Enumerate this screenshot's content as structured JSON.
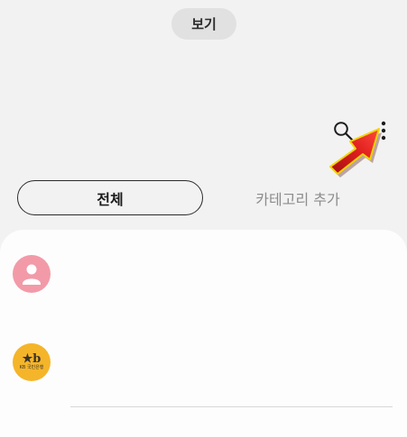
{
  "header": {
    "view_button_label": "보기"
  },
  "toolbar": {
    "search_icon": "search-icon",
    "more_icon": "more-options-icon"
  },
  "tabs": [
    {
      "label": "전체",
      "selected": true
    },
    {
      "label": "카테고리 추가",
      "selected": false
    }
  ],
  "contacts": [
    {
      "avatar": "person-avatar",
      "avatar_color": "#f29aa8"
    },
    {
      "avatar": "kb-bank-logo",
      "avatar_color": "#f5b52a",
      "logo_text": "KB 국민은행",
      "logo_mark": "★b"
    }
  ],
  "overlay": {
    "pointer_color": "#e0201f",
    "pointer_outline": "#f4d400"
  }
}
